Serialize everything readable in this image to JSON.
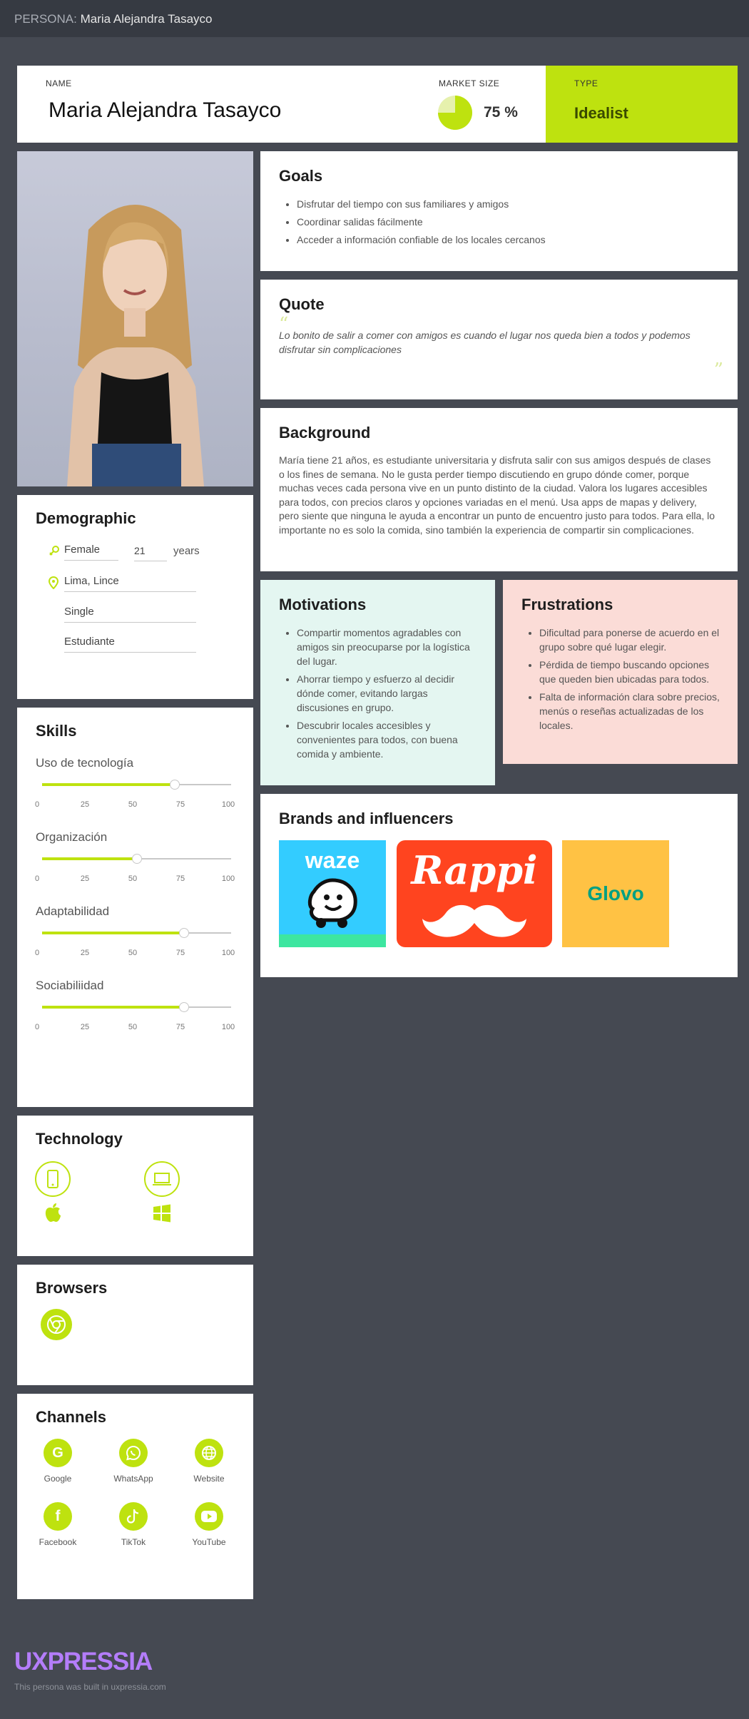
{
  "topbar": {
    "prefix": "PERSONA:",
    "name": "Maria Alejandra Tasayco"
  },
  "header": {
    "name_label": "NAME",
    "name": "Maria Alejandra Tasayco",
    "market_label": "MARKET SIZE",
    "market_value": "75 %",
    "market_fraction": 0.75,
    "type_label": "TYPE",
    "type_value": "Idealist"
  },
  "colors": {
    "accent": "#bee20f",
    "background": "#454952",
    "topbar": "#363a42",
    "motivations_bg": "#e4f6f1",
    "frustrations_bg": "#fbdcd7",
    "logo": "#b47dfa"
  },
  "goals": {
    "title": "Goals",
    "items": [
      "Disfrutar del tiempo con sus familiares y amigos",
      "Coordinar salidas fácilmente",
      "Acceder a información confiable de los locales cercanos"
    ]
  },
  "quote": {
    "title": "Quote",
    "text": "Lo bonito de salir a comer con amigos es cuando el lugar nos queda bien a todos y podemos disfrutar sin complicaciones"
  },
  "background": {
    "title": "Background",
    "text": "María tiene 21 años, es estudiante universitaria y disfruta salir con sus amigos después de clases o los fines de semana. No le gusta perder tiempo discutiendo en grupo dónde comer, porque muchas veces cada persona vive en un punto distinto de la ciudad. Valora los lugares accesibles para todos, con precios claros y opciones variadas en el menú. Usa apps de mapas y delivery, pero siente que ninguna le ayuda a encontrar un punto de encuentro justo para todos. Para ella, lo importante no es solo la comida, sino también la experiencia de compartir sin complicaciones."
  },
  "motivations": {
    "title": "Motivations",
    "items": [
      "Compartir momentos agradables con amigos sin preocuparse por la logística del lugar.",
      "Ahorrar tiempo y esfuerzo al decidir dónde comer, evitando largas discusiones en grupo.",
      "Descubrir locales accesibles y convenientes para todos, con buena comida y ambiente."
    ]
  },
  "frustrations": {
    "title": "Frustrations",
    "items": [
      "Dificultad para ponerse de acuerdo en el grupo sobre qué lugar elegir.",
      "Pérdida de tiempo buscando opciones que queden bien ubicadas para todos.",
      "Falta de información clara sobre precios, menús o reseñas actualizadas de los locales."
    ]
  },
  "brands": {
    "title": "Brands and influencers",
    "waze": "waze",
    "rappi": "Rappi",
    "glovo": "Glovo"
  },
  "demographic": {
    "title": "Demographic",
    "gender": "Female",
    "age": "21",
    "age_unit": "years",
    "location": "Lima, Lince",
    "status": "Single",
    "occupation": "Estudiante"
  },
  "skills": {
    "title": "Skills",
    "ticks": [
      "0",
      "25",
      "50",
      "75",
      "100"
    ],
    "items": [
      {
        "label": "Uso de tecnología",
        "value": 70
      },
      {
        "label": "Organización",
        "value": 50
      },
      {
        "label": "Adaptabilidad",
        "value": 75
      },
      {
        "label": "Sociabiliidad",
        "value": 75
      }
    ]
  },
  "technology": {
    "title": "Technology",
    "icons": [
      "smartphone-icon",
      "laptop-icon",
      "apple-icon",
      "windows-icon"
    ]
  },
  "browsers": {
    "title": "Browsers",
    "icons": [
      "chrome-icon"
    ]
  },
  "channels": {
    "title": "Channels",
    "items": [
      {
        "label": "Google",
        "icon": "google-icon"
      },
      {
        "label": "WhatsApp",
        "icon": "whatsapp-icon"
      },
      {
        "label": "Website",
        "icon": "globe-icon"
      },
      {
        "label": "Facebook",
        "icon": "facebook-icon"
      },
      {
        "label": "TikTok",
        "icon": "tiktok-icon"
      },
      {
        "label": "YouTube",
        "icon": "youtube-icon"
      }
    ]
  },
  "footer": {
    "logo": "UXPRESSIA",
    "note": "This persona was built in uxpressia.com"
  }
}
